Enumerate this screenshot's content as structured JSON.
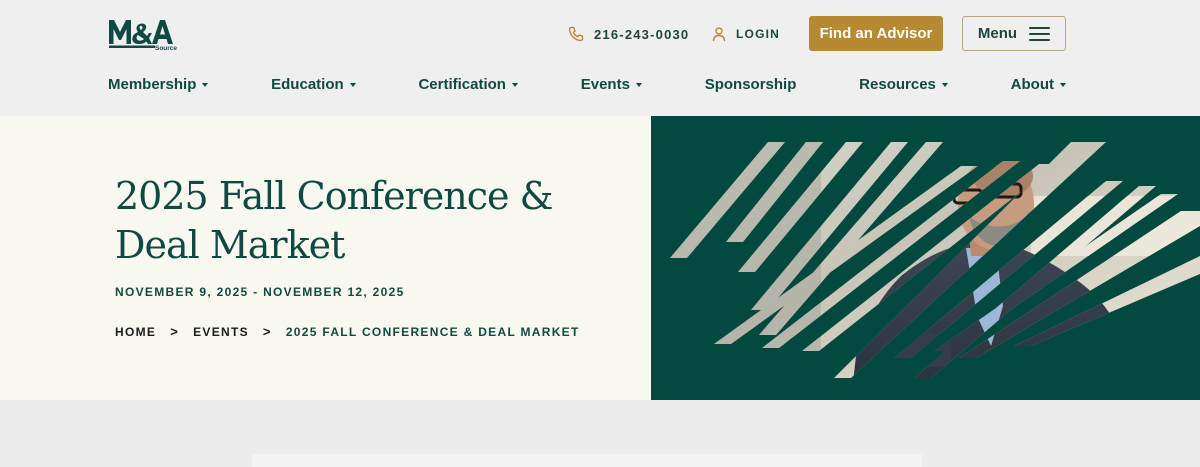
{
  "brand": {
    "logo_text": "M&A",
    "logo_subtext": "Source",
    "accent_color": "#b78933",
    "primary_color": "#0f4a42",
    "hero_bg_color": "#02493f"
  },
  "header": {
    "phone": "216-243-0030",
    "phone_icon": "phone-icon",
    "login_label": "LOGIN",
    "login_icon": "user-icon",
    "find_advisor_label": "Find an Advisor",
    "menu_label": "Menu",
    "menu_icon": "hamburger-icon"
  },
  "nav": {
    "items": [
      {
        "label": "Membership",
        "has_dropdown": true
      },
      {
        "label": "Education",
        "has_dropdown": true
      },
      {
        "label": "Certification",
        "has_dropdown": true
      },
      {
        "label": "Events",
        "has_dropdown": true
      },
      {
        "label": "Sponsorship",
        "has_dropdown": false
      },
      {
        "label": "Resources",
        "has_dropdown": true
      },
      {
        "label": "About",
        "has_dropdown": true
      }
    ]
  },
  "hero": {
    "title": "2025 Fall Conference & Deal Market",
    "dates": "NOVEMBER 9, 2025 - NOVEMBER 12, 2025",
    "breadcrumb": {
      "items": [
        "HOME",
        "EVENTS"
      ],
      "current": "2025 FALL CONFERENCE & DEAL MARKET",
      "separator": ">"
    },
    "image_alt": "Man in suit and glasses seen through diagonal stripes"
  }
}
